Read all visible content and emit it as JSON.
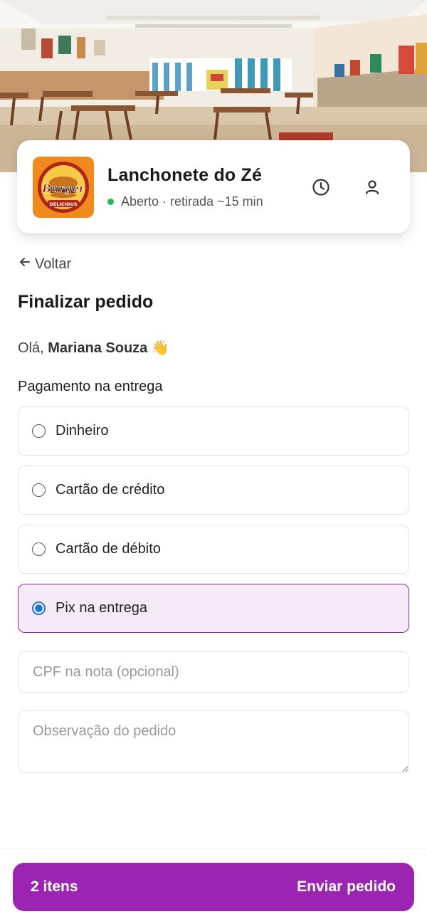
{
  "store": {
    "name": "Lanchonete do Zé",
    "status": "Aberto · retirada ~15 min",
    "logo_text_top": "Burger",
    "logo_text_bottom": "DELICIOUS",
    "status_color": "#1fbf4a",
    "logo_bg": "#f08a1c"
  },
  "header_icons": [
    "clock-icon",
    "user-icon"
  ],
  "nav": {
    "back_label": "Voltar"
  },
  "page": {
    "title": "Finalizar pedido",
    "greeting_prefix": "Olá,",
    "customer_name": "Mariana Souza",
    "greeting_emoji": "👋"
  },
  "payment": {
    "section_label": "Pagamento na entrega",
    "options": [
      {
        "label": "Dinheiro",
        "selected": false
      },
      {
        "label": "Cartão de crédito",
        "selected": false
      },
      {
        "label": "Cartão de débito",
        "selected": false
      },
      {
        "label": "Pix na entrega",
        "selected": true
      }
    ]
  },
  "form": {
    "cpf_placeholder": "CPF na nota (opcional)",
    "notes_placeholder": "Observação do pedido"
  },
  "footer": {
    "items_count": "2 itens",
    "submit_label": "Enviar pedido"
  },
  "colors": {
    "accent": "#9c24b3",
    "selected_bg": "#f6eaf8",
    "selected_border": "#8e2aa3",
    "radio_selected": "#1a73e8"
  }
}
